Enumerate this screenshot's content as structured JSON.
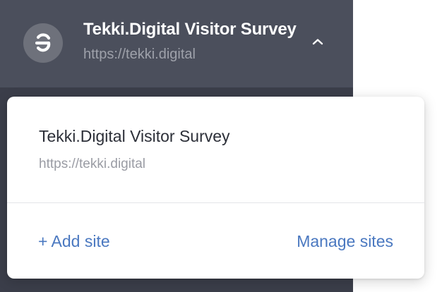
{
  "header": {
    "site_name": "Tekki.Digital Visitor Survey",
    "site_url": "https://tekki.digital"
  },
  "dropdown": {
    "site_name": "Tekki.Digital Visitor Survey",
    "site_url": "https://tekki.digital",
    "add_site_label": "+ Add site",
    "manage_sites_label": "Manage sites"
  },
  "colors": {
    "sidebar_bg": "#3b3e4a",
    "header_bg": "#4b4f5c",
    "link": "#4a78c0"
  },
  "icons": {
    "logo": "site-logo-icon",
    "chevron": "chevron-up-icon"
  }
}
